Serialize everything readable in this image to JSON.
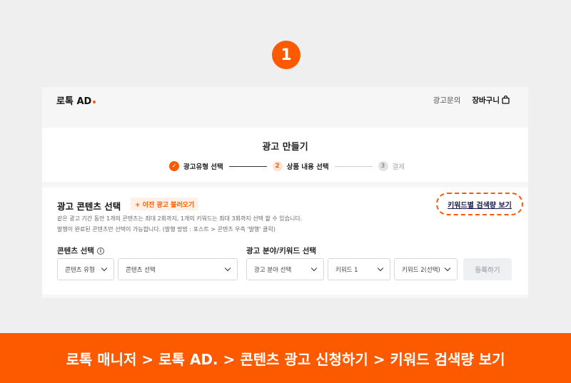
{
  "step_number": "1",
  "header": {
    "logo": "로톡 AD",
    "inquiry": "광고문의",
    "cart": "장바구니"
  },
  "steps": {
    "title": "광고 만들기",
    "items": [
      {
        "num": "✓",
        "label": "광고유형 선택",
        "state": "done"
      },
      {
        "num": "2",
        "label": "상품 내용 선택",
        "state": "current"
      },
      {
        "num": "3",
        "label": "결제",
        "state": "todo"
      }
    ]
  },
  "content": {
    "title": "광고 콘텐츠 선택",
    "load_prev": "+ 이전 광고 불러오기",
    "keyword_link": "키워드별 검색량 보기",
    "desc1": "같은 광고 기간 동안 1개의 콘텐츠는 최대 2회까지, 1개의 키워드는 최대 3회까지 선택 할 수 있습니다.",
    "desc2": "발행이 완료된 콘텐츠만 선택이 가능합니다. (발행 방법 : 포스트 > 콘텐츠 우측 '발행' 클릭)",
    "content_label": "콘텐츠 선택",
    "field_label": "광고 분야/키워드 선택",
    "selects": {
      "content_type": "콘텐츠 유형",
      "content_select": "콘텐츠 선택",
      "field_select": "광고 분야 선택",
      "keyword1": "키워드 1",
      "keyword2": "키워드 2(선택)"
    },
    "register": "등록하기"
  },
  "banner": "로톡 매니저 > 로톡 AD. > 콘텐츠 광고 신청하기 > 키워드 검색량 보기",
  "colors": {
    "accent": "#fd5a00",
    "background": "#efefef"
  }
}
